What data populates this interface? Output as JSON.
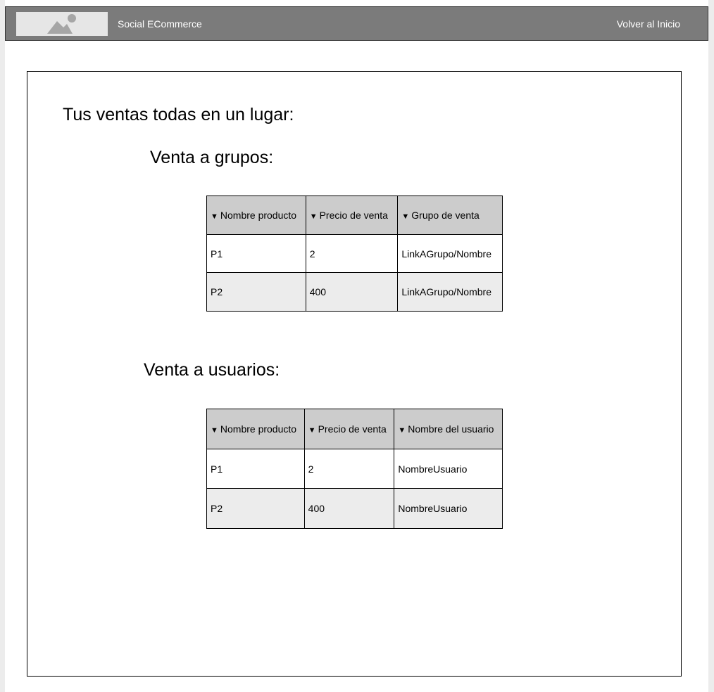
{
  "header": {
    "app_title": "Social ECommerce",
    "home_link": "Volver al Inicio",
    "logo_icon": "image-placeholder-icon"
  },
  "main": {
    "title": "Tus ventas todas en un lugar:",
    "groups_section": {
      "title": "Venta a grupos:",
      "columns": [
        "Nombre producto",
        "Precio de venta",
        "Grupo de venta"
      ],
      "rows": [
        [
          "P1",
          "2",
          "LinkAGrupo/Nombre"
        ],
        [
          "P2",
          "400",
          "LinkAGrupo/Nombre"
        ]
      ]
    },
    "users_section": {
      "title": "Venta a usuarios:",
      "columns": [
        "Nombre producto",
        "Precio de venta",
        "Nombre del usuario"
      ],
      "rows": [
        [
          "P1",
          "2",
          "NombreUsuario"
        ],
        [
          "P2",
          "400",
          "NombreUsuario"
        ]
      ]
    }
  },
  "colors": {
    "topbar": "#7b7b7b",
    "table_header": "#cccccc",
    "row_alt": "#ececec"
  }
}
